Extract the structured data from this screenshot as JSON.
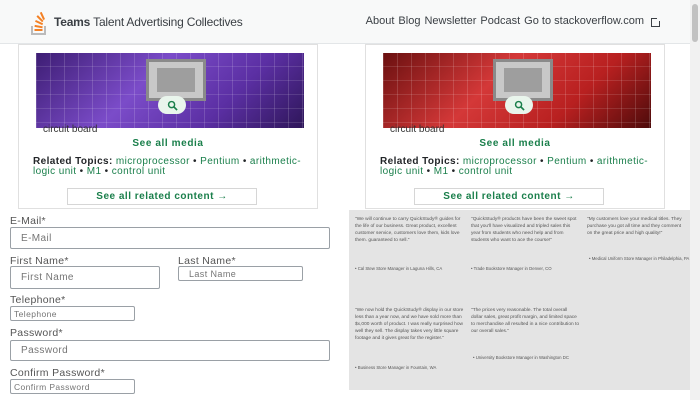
{
  "header": {
    "brand_bold": "Teams",
    "brand_rest": "Talent Advertising Collectives",
    "nav_items": [
      "About",
      "Blog",
      "Newsletter",
      "Podcast",
      "Go to stackoverflow.com"
    ]
  },
  "cards": [
    {
      "image_icon": "zoom-icon",
      "caption": "circuit board",
      "see_all_media": "See all media",
      "related_label": "Related Topics:",
      "related_topics": [
        "microprocessor",
        "Pentium",
        "arithmetic-logic unit",
        "M1",
        "control unit"
      ],
      "see_all_related": "See all related content →"
    },
    {
      "image_icon": "zoom-icon",
      "caption": "circuit board",
      "see_all_media": "See all media",
      "related_label": "Related Topics:",
      "related_topics": [
        "microprocessor",
        "Pentium",
        "arithmetic-logic unit",
        "M1",
        "control unit"
      ],
      "see_all_related": "See all related content →"
    }
  ],
  "form": {
    "email_label": "E-Mail*",
    "email_placeholder": "E-Mail",
    "first_name_label": "First Name*",
    "first_name_placeholder": "First Name",
    "last_name_label": "Last Name*",
    "last_name_placeholder": "Last Name",
    "telephone_label": "Telephone*",
    "telephone_placeholder": "Telephone",
    "password_label": "Password*",
    "password_placeholder": "Password",
    "confirm_password_label": "Confirm Password*",
    "confirm_password_placeholder": "Confirm Password"
  },
  "testimonials": [
    {
      "quote": "\"We will continue to carry QuickStudy® guides for the life of our business. Great product, excellent customer service, customers love them, kids love them. guaranteed to sell.\"",
      "attribution": "• Cal Stew Store Manager in Laguna Hills, CA"
    },
    {
      "quote": "\"QuickStudy® products have been the sweet spot that you'll have visualized and tripled sales this year from students who need help and from students who want to ace the course!\"",
      "attribution": "• Trade Bookstore Manager in Denver, CO"
    },
    {
      "quote": "\"My customers love your medical titles. They purchase you got all time and they comment on the great price and high quality!\"",
      "attribution": "• Medical Uniform Store Manager in Philadelphia, PA"
    },
    {
      "quote": "\"We now hold the QuickStudy® display in our store less than a year now, and we have sold more than $x,000 worth of product. I was really surprised how well they sell. The display takes very little square footage and it gives great for the register.\"",
      "attribution": "• Business Store Manager in Fountain, WA"
    },
    {
      "quote": "\"The prices very reasonable. The total overall dollar sales, great profit margin, and limited space to merchandise all resulted in a nice contribution to our overall sales.\"",
      "attribution": "• University Bookstore Manager in Washington DC"
    }
  ],
  "colors": {
    "accent": "#1a7f4b",
    "logo_orange": "#f48024",
    "panel_gray": "#e4e4e4"
  }
}
